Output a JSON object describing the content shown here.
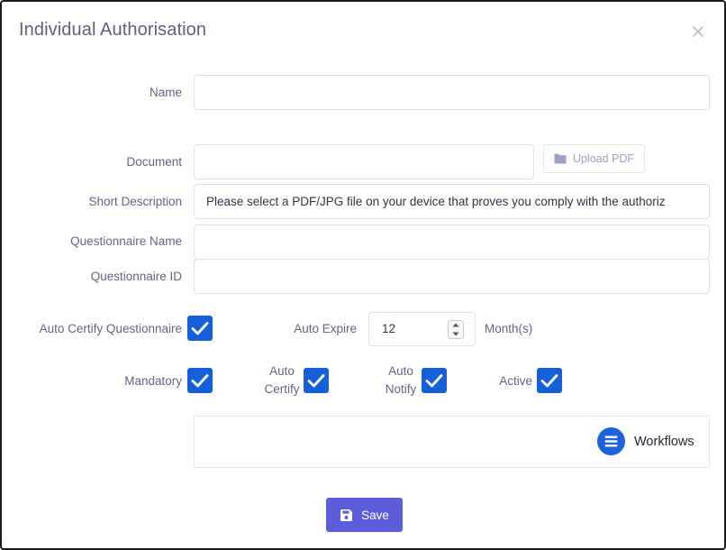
{
  "modal": {
    "title": "Individual Authorisation"
  },
  "form": {
    "name_label": "Name",
    "name_value": "",
    "document_label": "Document",
    "document_value": "",
    "upload_label": "Upload PDF",
    "short_description_label": "Short Description",
    "short_description_value": "Please select a PDF/JPG file on your device that proves you comply with the authoriz",
    "questionnaire_name_label": "Questionnaire Name",
    "questionnaire_name_value": "",
    "questionnaire_id_label": "Questionnaire ID",
    "questionnaire_id_value": "",
    "auto_certify_questionnaire_label": "Auto Certify Questionnaire",
    "auto_certify_questionnaire_checked": true,
    "auto_expire_label": "Auto Expire",
    "auto_expire_value": "12",
    "auto_expire_unit": "Month(s)",
    "mandatory_label": "Mandatory",
    "mandatory_checked": true,
    "auto_certify_label_line1": "Auto",
    "auto_certify_label_line2": "Certify",
    "auto_certify_checked": true,
    "auto_notify_label_line1": "Auto",
    "auto_notify_label_line2": "Notify",
    "auto_notify_checked": true,
    "active_label": "Active",
    "active_checked": true
  },
  "workflows": {
    "label": "Workflows"
  },
  "footer": {
    "save_label": "Save"
  },
  "colors": {
    "accent": "#5d5ddb",
    "checkbox": "#1560d8",
    "workflow_icon": "#1d63dc",
    "title": "#5a6183"
  },
  "icons": {
    "close": "close-icon",
    "upload": "folder-icon",
    "checkbox": "check-icon",
    "workflow": "list-icon",
    "save": "floppy-disk-icon"
  }
}
